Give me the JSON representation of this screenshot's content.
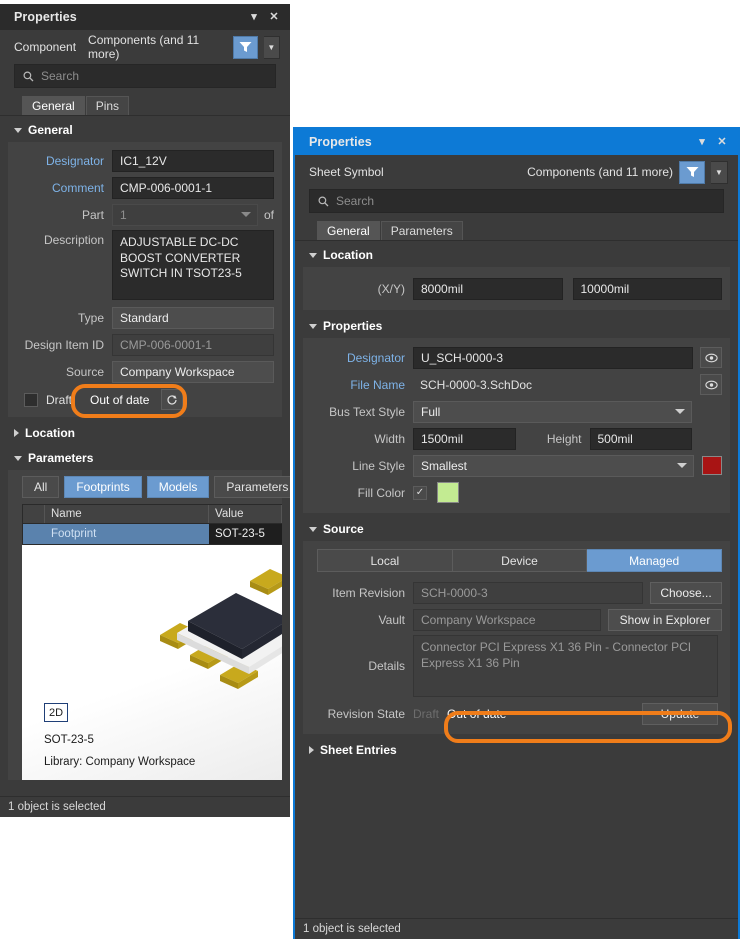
{
  "left_panel": {
    "title": "Properties",
    "collapse_icon": "chevron-down-icon",
    "close_icon": "close-icon",
    "object_type": "Component",
    "object_scope": "Components (and 11 more)",
    "filter_icon": "funnel-icon",
    "filter_dropdown_icon": "chevron-down-icon",
    "search_placeholder": "Search",
    "search_icon": "search-icon",
    "tabs": [
      {
        "label": "General",
        "active": true
      },
      {
        "label": "Pins",
        "active": false
      }
    ],
    "sections": {
      "general": {
        "title": "General",
        "expanded": true,
        "fields": {
          "designator_label": "Designator",
          "designator_value": "IC1_12V",
          "comment_label": "Comment",
          "comment_value": "CMP-006-0001-1",
          "part_label": "Part",
          "part_value": "1",
          "part_of_label": "of",
          "description_label": "Description",
          "description_value": "ADJUSTABLE DC-DC BOOST CONVERTER SWITCH IN  TSOT23-5",
          "type_label": "Type",
          "type_value": "Standard",
          "design_item_id_label": "Design Item ID",
          "design_item_id_value": "CMP-006-0001-1",
          "source_label": "Source",
          "source_value": "Company Workspace",
          "draft_label": "Draft",
          "draft_checked": false,
          "state_text": "Out of date",
          "refresh_icon": "refresh-icon"
        }
      },
      "location": {
        "title": "Location",
        "expanded": false
      },
      "parameters": {
        "title": "Parameters",
        "expanded": true,
        "chips": [
          {
            "label": "All",
            "active": false
          },
          {
            "label": "Footprints",
            "active": true
          },
          {
            "label": "Models",
            "active": true
          },
          {
            "label": "Parameters",
            "active": false
          }
        ],
        "columns": [
          "",
          "Name",
          "Value"
        ],
        "rows": [
          {
            "name": "Footprint",
            "value": "SOT-23-5",
            "selected": true
          }
        ],
        "preview": {
          "view_mode_label": "2D",
          "footprint_name": "SOT-23-5",
          "library_text": "Library: Company Workspace"
        }
      }
    },
    "status_text": "1 object is selected"
  },
  "right_panel": {
    "title": "Properties",
    "collapse_icon": "chevron-down-icon",
    "close_icon": "close-icon",
    "object_type": "Sheet Symbol",
    "object_scope": "Components (and 11 more)",
    "filter_icon": "funnel-icon",
    "filter_dropdown_icon": "chevron-down-icon",
    "search_placeholder": "Search",
    "search_icon": "search-icon",
    "tabs": [
      {
        "label": "General",
        "active": true
      },
      {
        "label": "Parameters",
        "active": false
      }
    ],
    "sections": {
      "location": {
        "title": "Location",
        "expanded": true,
        "xy_label": "(X/Y)",
        "x_value": "8000mil",
        "y_value": "10000mil"
      },
      "properties": {
        "title": "Properties",
        "expanded": true,
        "designator_label": "Designator",
        "designator_value": "U_SCH-0000-3",
        "designator_eye_icon": "eye-icon",
        "file_name_label": "File Name",
        "file_name_value": "SCH-0000-3.SchDoc",
        "file_name_eye_icon": "eye-icon",
        "bus_text_style_label": "Bus Text Style",
        "bus_text_style_value": "Full",
        "width_label": "Width",
        "width_value": "1500mil",
        "height_label": "Height",
        "height_value": "500mil",
        "line_style_label": "Line Style",
        "line_style_value": "Smallest",
        "line_color": "#a81414",
        "fill_color_label": "Fill Color",
        "fill_color_checked": true,
        "fill_color": "#c3eb92"
      },
      "source": {
        "title": "Source",
        "expanded": true,
        "modes": [
          {
            "label": "Local",
            "active": false
          },
          {
            "label": "Device",
            "active": false
          },
          {
            "label": "Managed",
            "active": true
          }
        ],
        "item_revision_label": "Item Revision",
        "item_revision_value": "SCH-0000-3",
        "choose_label": "Choose...",
        "vault_label": "Vault",
        "vault_value": "Company Workspace",
        "show_in_explorer_label": "Show in Explorer",
        "details_label": "Details",
        "details_value": "Connector PCI Express X1 36 Pin - Connector PCI Express X1 36 Pin",
        "revision_state_label": "Revision State",
        "revision_state_draft": "Draft",
        "revision_state_value": "Out of date",
        "update_label": "Update"
      },
      "sheet_entries": {
        "title": "Sheet Entries",
        "expanded": false
      }
    },
    "status_text": "1 object is selected"
  },
  "annotations": {
    "highlight_color": "#f07d1a"
  }
}
